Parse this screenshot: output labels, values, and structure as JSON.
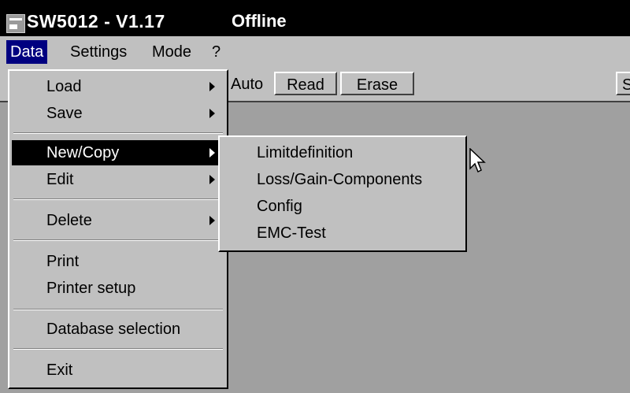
{
  "window": {
    "title": "SW5012 - V1.17",
    "status": "Offline",
    "icon": "app-icon"
  },
  "menubar": {
    "items": [
      {
        "label": "Data",
        "accel": "D"
      },
      {
        "label": "Settings",
        "accel": "S"
      },
      {
        "label": "Mode",
        "accel": "M"
      },
      {
        "label": "?"
      }
    ]
  },
  "toolbar": {
    "mode_text": "Auto",
    "read_label": "Read",
    "erase_label": "Erase",
    "cut_button_label": "S"
  },
  "data_menu": {
    "items": [
      {
        "label": "Load",
        "submenu": true
      },
      {
        "label": "Save",
        "submenu": true
      },
      {
        "label": "New/Copy",
        "submenu": true,
        "highlighted": true
      },
      {
        "label": "Edit",
        "submenu": true
      },
      {
        "label": "Delete",
        "submenu": true
      },
      {
        "label": "Print"
      },
      {
        "label": "Printer setup"
      },
      {
        "label": "Database selection"
      },
      {
        "label": "Exit"
      }
    ]
  },
  "new_copy_submenu": {
    "items": [
      {
        "label": "Limitdefinition"
      },
      {
        "label": "Loss/Gain-Components"
      },
      {
        "label": "Config"
      },
      {
        "label": "EMC-Test"
      }
    ]
  },
  "colors": {
    "titlebar": "#000000",
    "menu_highlight": "#000000",
    "face": "#c0c0c0",
    "workspace": "#a0a0a0",
    "active_menu": "#000080"
  }
}
